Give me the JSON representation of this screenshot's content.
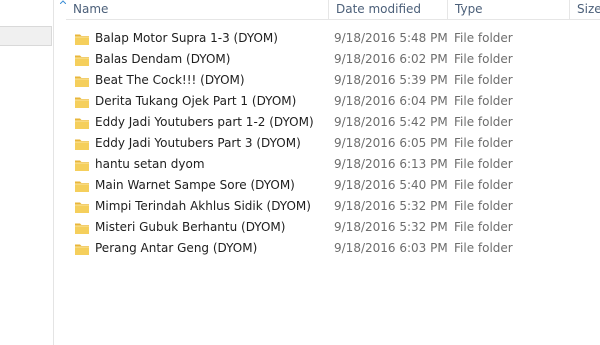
{
  "columns": {
    "name": "Name",
    "date_modified": "Date modified",
    "type": "Type",
    "size": "Size"
  },
  "colors": {
    "folder": "#f2c94c",
    "header_text": "#4c607a"
  },
  "rows": [
    {
      "name": "Balap Motor Supra 1-3 (DYOM)",
      "date": "9/18/2016 5:48 PM",
      "type": "File folder",
      "icon": "folder-icon"
    },
    {
      "name": "Balas Dendam (DYOM)",
      "date": "9/18/2016 6:02 PM",
      "type": "File folder",
      "icon": "folder-icon"
    },
    {
      "name": "Beat The Cock!!! (DYOM)",
      "date": "9/18/2016 5:39 PM",
      "type": "File folder",
      "icon": "folder-icon"
    },
    {
      "name": "Derita Tukang Ojek Part 1 (DYOM)",
      "date": "9/18/2016 6:04 PM",
      "type": "File folder",
      "icon": "folder-icon"
    },
    {
      "name": "Eddy Jadi Youtubers part 1-2 (DYOM)",
      "date": "9/18/2016 5:42 PM",
      "type": "File folder",
      "icon": "folder-icon"
    },
    {
      "name": "Eddy Jadi Youtubers Part 3 (DYOM)",
      "date": "9/18/2016 6:05 PM",
      "type": "File folder",
      "icon": "folder-icon"
    },
    {
      "name": "hantu setan dyom",
      "date": "9/18/2016 6:13 PM",
      "type": "File folder",
      "icon": "folder-icon"
    },
    {
      "name": "Main Warnet Sampe Sore (DYOM)",
      "date": "9/18/2016 5:40 PM",
      "type": "File folder",
      "icon": "folder-icon"
    },
    {
      "name": "Mimpi Terindah Akhlus Sidik (DYOM)",
      "date": "9/18/2016 5:32 PM",
      "type": "File folder",
      "icon": "folder-icon"
    },
    {
      "name": "Misteri Gubuk Berhantu (DYOM)",
      "date": "9/18/2016 5:32 PM",
      "type": "File folder",
      "icon": "folder-icon"
    },
    {
      "name": "Perang Antar Geng (DYOM)",
      "date": "9/18/2016 6:03 PM",
      "type": "File folder",
      "icon": "folder-icon"
    }
  ]
}
